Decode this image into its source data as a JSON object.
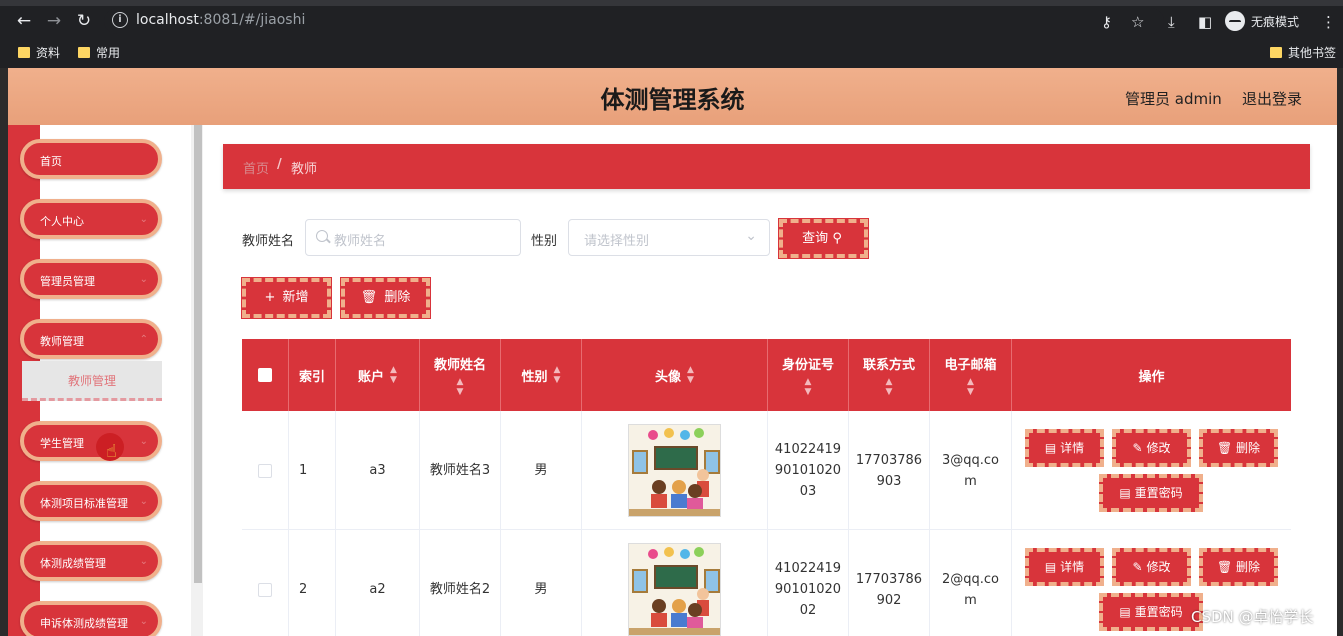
{
  "browser": {
    "url_host": "localhost",
    "url_rest": ":8081/#/jiaoshi",
    "incognito_label": "无痕模式",
    "bookmarks": [
      "资料",
      "常用"
    ],
    "other_bookmarks": "其他书签"
  },
  "header": {
    "title": "体测管理系统",
    "user": "管理员 admin",
    "logout": "退出登录"
  },
  "sidebar": {
    "items": [
      {
        "label": "首页"
      },
      {
        "label": "个人中心"
      },
      {
        "label": "管理员管理"
      },
      {
        "label": "教师管理"
      },
      {
        "label": "学生管理"
      },
      {
        "label": "体测项目标准管理"
      },
      {
        "label": "体测成绩管理"
      },
      {
        "label": "申诉体测成绩管理"
      }
    ],
    "submenu": "教师管理"
  },
  "breadcrumb": {
    "home": "首页",
    "separator": "/",
    "current": "教师"
  },
  "search": {
    "name_label": "教师姓名",
    "name_placeholder": "教师姓名",
    "gender_label": "性别",
    "gender_placeholder": "请选择性别",
    "query_button": "查询"
  },
  "actions": {
    "add": "新增",
    "delete": "删除"
  },
  "table": {
    "columns": [
      "索引",
      "账户",
      "教师姓名",
      "性别",
      "头像",
      "身份证号",
      "联系方式",
      "电子邮箱",
      "操作"
    ],
    "rows": [
      {
        "index": "1",
        "account": "a3",
        "name": "教师姓名3",
        "gender": "男",
        "id_l1": "41022419",
        "id_l2": "90101020",
        "id_l3": "03",
        "phone_l1": "17703786",
        "phone_l2": "903",
        "email_l1": "3@qq.co",
        "email_l2": "m"
      },
      {
        "index": "2",
        "account": "a2",
        "name": "教师姓名2",
        "gender": "男",
        "id_l1": "41022419",
        "id_l2": "90101020",
        "id_l3": "02",
        "phone_l1": "17703786",
        "phone_l2": "902",
        "email_l1": "2@qq.co",
        "email_l2": "m"
      }
    ],
    "row_actions": {
      "detail": "详情",
      "edit": "修改",
      "delete": "删除",
      "reset": "重置密码"
    }
  },
  "watermark": "CSDN @卓怡学长",
  "colors": {
    "primary_red": "#d8343b",
    "peach": "#f0b08c"
  }
}
